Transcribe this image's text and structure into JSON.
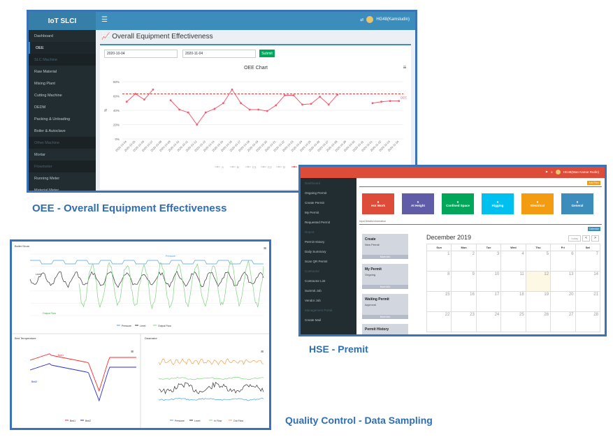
{
  "captions": {
    "oee": "OEE - Overall Equipment Effectiveness",
    "hse": "HSE - Premit",
    "qc": "Quality Control - Data Sampling"
  },
  "oee": {
    "brand": "IoT SLCI",
    "user": "HG48(Kamsludin)",
    "sidebar": [
      {
        "label": "Dashboard",
        "type": "item"
      },
      {
        "label": "OEE",
        "type": "active"
      },
      {
        "label": "SLC Machine",
        "type": "hdr"
      },
      {
        "label": "Raw Material",
        "type": "item"
      },
      {
        "label": "Mixing Plant",
        "type": "item"
      },
      {
        "label": "Cutting Machine",
        "type": "item"
      },
      {
        "label": "DEDM",
        "type": "item"
      },
      {
        "label": "Packing & Unloading",
        "type": "item"
      },
      {
        "label": "Boiler & Autoclave",
        "type": "item"
      },
      {
        "label": "Other Machine",
        "type": "hdr"
      },
      {
        "label": "Mortar",
        "type": "item"
      },
      {
        "label": "Flowmeter",
        "type": "hdr"
      },
      {
        "label": "Running Meter",
        "type": "item"
      },
      {
        "label": "Material Meter",
        "type": "item"
      }
    ],
    "page_title": "Overall Equipment Effectiveness",
    "date_from": "2020-10-04",
    "date_to": "2020-11-04",
    "submit_label": "Submit",
    "chart_title": "OEE Chart",
    "credits": "Highcharts.com",
    "legend": [
      "A",
      "B",
      "C1",
      "C2",
      "D",
      "OEE"
    ]
  },
  "chart_data": {
    "type": "line",
    "title": "OEE Chart",
    "ylabel": "%",
    "yticks": [
      "80%",
      "60%",
      "40%",
      "20%",
      "0%"
    ],
    "ylim": [
      0,
      80
    ],
    "x": [
      "2020-10-04",
      "2020-10-05",
      "2020-10-06",
      "2020-10-07",
      "2020-10-08",
      "2020-10-09",
      "2020-10-10",
      "2020-10-11",
      "2020-10-12",
      "2020-10-13",
      "2020-10-14",
      "2020-10-15",
      "2020-10-16",
      "2020-10-17",
      "2020-10-18",
      "2020-10-19",
      "2020-10-20",
      "2020-10-21",
      "2020-10-22",
      "2020-10-23",
      "2020-10-24",
      "2020-10-25",
      "2020-10-26",
      "2020-10-27",
      "2020-10-28",
      "2020-10-29",
      "2020-10-30",
      "2020-10-31",
      "2020-11-01",
      "2020-11-02",
      "2020-11-03",
      "2020-11-04"
    ],
    "series": [
      {
        "name": "OEE",
        "values": [
          52,
          63,
          55,
          69,
          null,
          54,
          41,
          37,
          20,
          37,
          42,
          50,
          69,
          50,
          41,
          41,
          39,
          47,
          61,
          61,
          48,
          49,
          59,
          48,
          62,
          null,
          null,
          null,
          50,
          52,
          53,
          53
        ]
      }
    ],
    "target_line": 63,
    "series_label": "OEE",
    "legend_position": "bottom"
  },
  "hse": {
    "user": "HG48(Wan Kamar Rudin)",
    "badge": "Add Files",
    "sidebar": [
      {
        "label": "Dashboard",
        "type": "hdr"
      },
      {
        "label": "Ongoing Permit",
        "type": "item"
      },
      {
        "label": "Create Permit",
        "type": "item"
      },
      {
        "label": "My Permit",
        "type": "item"
      },
      {
        "label": "Requested Permit",
        "type": "item"
      },
      {
        "label": "Report",
        "type": "hdr"
      },
      {
        "label": "Permit History",
        "type": "item"
      },
      {
        "label": "Daily Summary",
        "type": "item"
      },
      {
        "label": "Scan QR Permit",
        "type": "item"
      },
      {
        "label": "Contractor",
        "type": "hdr"
      },
      {
        "label": "Contractor List",
        "type": "item"
      },
      {
        "label": "Summit Job",
        "type": "item"
      },
      {
        "label": "Vendor Job",
        "type": "item"
      },
      {
        "label": "Management Portal",
        "type": "hdr"
      },
      {
        "label": "Create Mail",
        "type": "item"
      }
    ],
    "tiles": [
      {
        "label": "Hot Work",
        "color": "#dd4b39"
      },
      {
        "label": "At Height",
        "color": "#605ca8"
      },
      {
        "label": "Confined Space",
        "color": "#00a65a"
      },
      {
        "label": "Rigging",
        "color": "#00c0ef"
      },
      {
        "label": "Electrical",
        "color": "#f39c12"
      },
      {
        "label": "General",
        "color": "#3c8dbc"
      }
    ],
    "subline": "Input Details Information",
    "calendar_btn": "Calendar",
    "cards": [
      {
        "title": "Create",
        "sub": "New Permit",
        "foot": "More info"
      },
      {
        "title": "My Permit",
        "sub": "Ongoing",
        "foot": "More info"
      },
      {
        "title": "Waiting Permit",
        "sub": "Approval",
        "foot": "More info"
      },
      {
        "title": "Permit History",
        "sub": "",
        "foot": "More info"
      }
    ],
    "calendar": {
      "month": "December 2019",
      "today_label": "today",
      "prev": "<",
      "next": ">",
      "days": [
        "Sun",
        "Mon",
        "Tue",
        "Wed",
        "Thu",
        "Fri",
        "Sat"
      ],
      "weeks": [
        [
          "1",
          "2",
          "3",
          "4",
          "5",
          "6",
          "7"
        ],
        [
          "8",
          "9",
          "10",
          "11",
          "12",
          "13",
          "14"
        ],
        [
          "15",
          "16",
          "17",
          "18",
          "19",
          "20",
          "21"
        ],
        [
          "22",
          "23",
          "24",
          "25",
          "26",
          "27",
          "28"
        ]
      ]
    }
  },
  "qc": {
    "top_title": "Boiler Drum",
    "top_legend": [
      "Pressure",
      "Level",
      "Output Flow"
    ],
    "top_labels": {
      "pressure": "Pressure",
      "level": "Level",
      "output": "Output Flow"
    },
    "bl_title": "Bed Temperature",
    "bl_labels": [
      "Bed1",
      "Bed2"
    ],
    "br_title": "Deaerator",
    "br_legend": [
      "Pressure",
      "Level",
      "In Flow",
      "Out Flow"
    ],
    "colors": {
      "pressure": "#4aa3df",
      "level": "#333333",
      "flow": "#7fd37f",
      "bed1": "#ff2b2b",
      "bed2": "#2b2bd9",
      "orange": "#f0a050"
    }
  }
}
